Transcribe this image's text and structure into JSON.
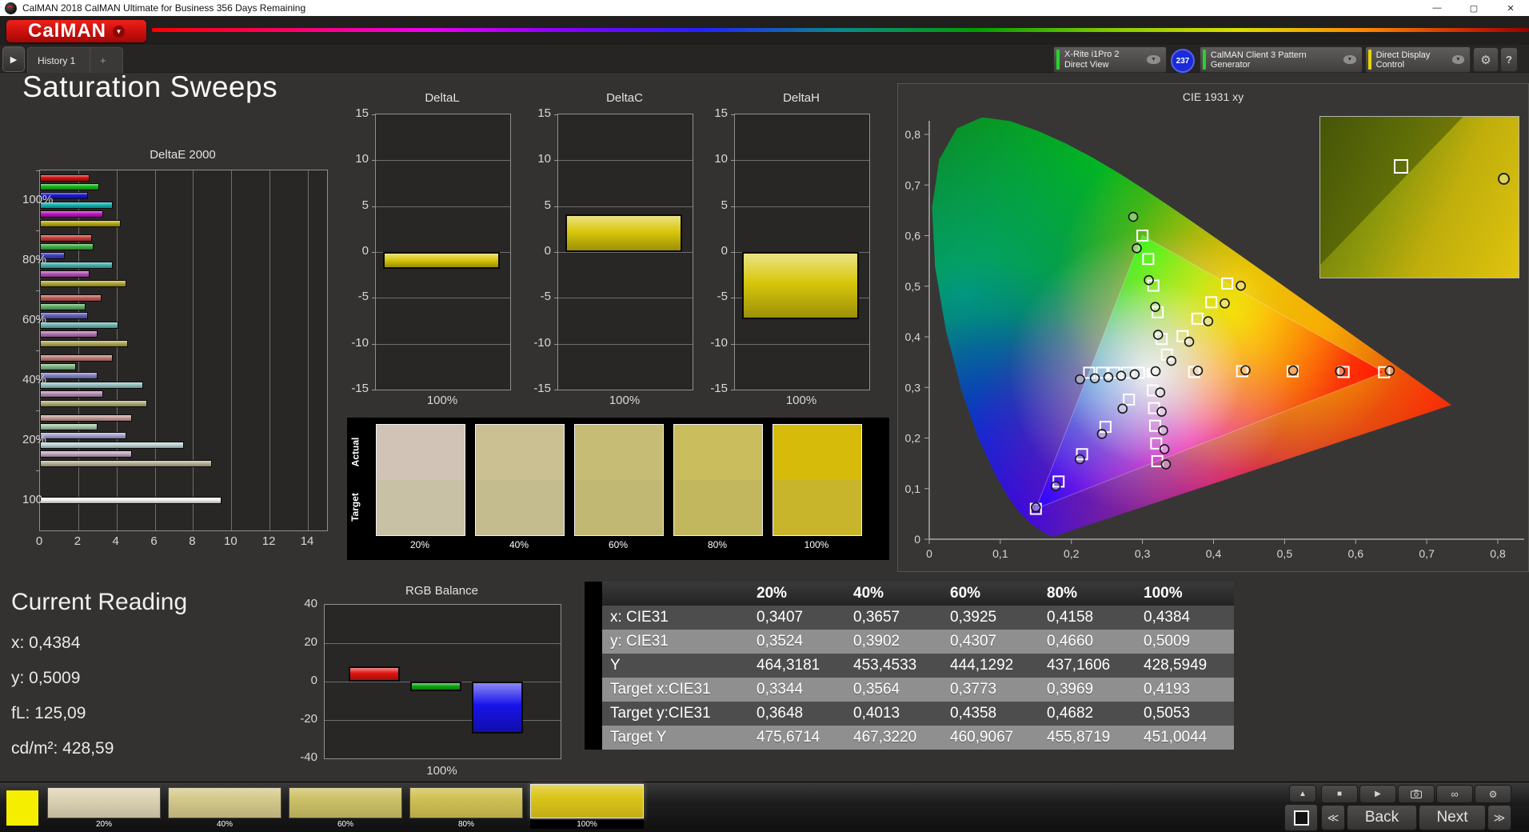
{
  "window": {
    "title": "CalMAN 2018 CalMAN Ultimate for Business 356 Days Remaining",
    "minimize": "—",
    "maximize": "▢",
    "close": "✕"
  },
  "logo": {
    "text": "CalMAN"
  },
  "tabs": {
    "history": "History 1",
    "add": "+"
  },
  "toolbar": {
    "meter": {
      "line1": "X-Rite i1Pro 2",
      "line2": "Direct View",
      "stripe": "#27d32b",
      "badge": "237"
    },
    "source": {
      "label": "CalMAN Client 3 Pattern Generator",
      "stripe": "#27d32b"
    },
    "display": {
      "label": "Direct Display Control",
      "stripe": "#e8d40a"
    },
    "settings": "⚙",
    "help": "?",
    "collapse": "◀"
  },
  "page": {
    "title": "Saturation Sweeps"
  },
  "current_reading": {
    "title": "Current Reading",
    "lines": [
      "x: 0,4384",
      "y: 0,5009",
      "fL: 125,09",
      "cd/m²: 428,59"
    ]
  },
  "chart_data": [
    {
      "id": "deltaE2000",
      "type": "bar",
      "orientation": "horizontal",
      "title": "DeltaE 2000",
      "xlim": [
        0,
        15
      ],
      "xticks": [
        0,
        2,
        4,
        6,
        8,
        10,
        12,
        14
      ],
      "grid": true,
      "groups": [
        {
          "label": "100%",
          "bars": [
            {
              "name": "Red",
              "value": 2.6,
              "color": "#d01210"
            },
            {
              "name": "Green",
              "value": 3.1,
              "color": "#14b419"
            },
            {
              "name": "Blue",
              "value": 2.5,
              "color": "#1716cf"
            },
            {
              "name": "Cyan",
              "value": 3.8,
              "color": "#12b3b3"
            },
            {
              "name": "Magenta",
              "value": 3.3,
              "color": "#c013c3"
            },
            {
              "name": "Yellow",
              "value": 4.2,
              "color": "#b7ab0e"
            }
          ]
        },
        {
          "label": "80%",
          "bars": [
            {
              "name": "Red",
              "value": 2.7,
              "color": "#c73f38"
            },
            {
              "name": "Green",
              "value": 2.8,
              "color": "#3dae42"
            },
            {
              "name": "Blue",
              "value": 1.3,
              "color": "#3f3ec4"
            },
            {
              "name": "Cyan",
              "value": 3.8,
              "color": "#47b1b1"
            },
            {
              "name": "Magenta",
              "value": 2.6,
              "color": "#b452b4"
            },
            {
              "name": "Yellow",
              "value": 4.5,
              "color": "#b2a733"
            }
          ]
        },
        {
          "label": "60%",
          "bars": [
            {
              "name": "Red",
              "value": 3.2,
              "color": "#c05d57"
            },
            {
              "name": "Green",
              "value": 2.4,
              "color": "#5cb061"
            },
            {
              "name": "Blue",
              "value": 2.5,
              "color": "#6160bd"
            },
            {
              "name": "Cyan",
              "value": 4.1,
              "color": "#6fb6b6"
            },
            {
              "name": "Magenta",
              "value": 3.0,
              "color": "#b273b2"
            },
            {
              "name": "Yellow",
              "value": 4.6,
              "color": "#b0a854"
            }
          ]
        },
        {
          "label": "40%",
          "bars": [
            {
              "name": "Red",
              "value": 3.8,
              "color": "#c17d78"
            },
            {
              "name": "Green",
              "value": 1.9,
              "color": "#7fb883"
            },
            {
              "name": "Blue",
              "value": 3.0,
              "color": "#8382c4"
            },
            {
              "name": "Cyan",
              "value": 5.4,
              "color": "#97c2c2"
            },
            {
              "name": "Magenta",
              "value": 3.3,
              "color": "#b78fb7"
            },
            {
              "name": "Yellow",
              "value": 5.6,
              "color": "#b2ab76"
            }
          ]
        },
        {
          "label": "20%",
          "bars": [
            {
              "name": "Red",
              "value": 4.8,
              "color": "#c59d99"
            },
            {
              "name": "Green",
              "value": 3.0,
              "color": "#a3c6a6"
            },
            {
              "name": "Blue",
              "value": 4.5,
              "color": "#a6a5cf"
            },
            {
              "name": "Cyan",
              "value": 7.5,
              "color": "#bdd3d4"
            },
            {
              "name": "Magenta",
              "value": 4.8,
              "color": "#c2a9c2"
            },
            {
              "name": "Yellow",
              "value": 9.0,
              "color": "#b7b194"
            }
          ]
        },
        {
          "label": "100",
          "bars": [
            {
              "name": "White",
              "value": 9.5,
              "color": "#f0f0f0"
            }
          ]
        }
      ]
    },
    {
      "id": "deltaL",
      "type": "bar",
      "title": "DeltaL",
      "ylim": [
        -15,
        15
      ],
      "yticks": [
        15,
        10,
        5,
        0,
        -5,
        -10,
        -15
      ],
      "xlabel": "100%",
      "value": -1.8,
      "color": "#d8c70b"
    },
    {
      "id": "deltaC",
      "type": "bar",
      "title": "DeltaC",
      "ylim": [
        -15,
        15
      ],
      "yticks": [
        15,
        10,
        5,
        0,
        -5,
        -10,
        -15
      ],
      "xlabel": "100%",
      "value": 4.1,
      "color": "#d8c70b"
    },
    {
      "id": "deltaH",
      "type": "bar",
      "title": "DeltaH",
      "ylim": [
        -15,
        15
      ],
      "yticks": [
        15,
        10,
        5,
        0,
        -5,
        -10,
        -15
      ],
      "xlabel": "100%",
      "value": -7.3,
      "color": "#d8c70b"
    },
    {
      "id": "rgbBalance",
      "type": "bar",
      "title": "RGB Balance",
      "ylim": [
        -40,
        40
      ],
      "yticks": [
        40,
        20,
        0,
        -20,
        -40
      ],
      "xlabel": "100%",
      "bars": [
        {
          "name": "Red",
          "value": 8,
          "color": "#e01310"
        },
        {
          "name": "Green",
          "value": -5,
          "color": "#0da512"
        },
        {
          "name": "Blue",
          "value": -27,
          "color": "#1813ea"
        }
      ]
    },
    {
      "id": "cie1931",
      "type": "scatter",
      "title": "CIE 1931 xy",
      "xlim": [
        0,
        0.8
      ],
      "ylim": [
        0,
        0.8
      ],
      "xtick_labels": [
        "0",
        "0,1",
        "0,2",
        "0,3",
        "0,4",
        "0,5",
        "0,6",
        "0,7",
        "0,8"
      ],
      "ytick_labels": [
        "0",
        "0,1",
        "0,2",
        "0,3",
        "0,4",
        "0,5",
        "0,6",
        "0,7",
        "0,8"
      ],
      "white_point": {
        "target": [
          0.3127,
          0.329
        ],
        "measured": [
          0.3185,
          0.332
        ]
      },
      "sweeps": [
        {
          "name": "Red",
          "target": [
            [
              0.3727,
              0.3305
            ],
            [
              0.4402,
              0.3319
            ],
            [
              0.5114,
              0.3318
            ],
            [
              0.583,
              0.3305
            ],
            [
              0.64,
              0.33
            ]
          ],
          "measured": [
            [
              0.378,
              0.333
            ],
            [
              0.445,
              0.334
            ],
            [
              0.512,
              0.3335
            ],
            [
              0.578,
              0.332
            ],
            [
              0.648,
              0.333
            ]
          ]
        },
        {
          "name": "Green",
          "target": [
            [
              0.327,
              0.3958
            ],
            [
              0.3214,
              0.4485
            ],
            [
              0.3154,
              0.5011
            ],
            [
              0.3082,
              0.5538
            ],
            [
              0.3,
              0.6
            ]
          ],
          "measured": [
            [
              0.322,
              0.404
            ],
            [
              0.318,
              0.459
            ],
            [
              0.309,
              0.512
            ],
            [
              0.292,
              0.575
            ],
            [
              0.287,
              0.637
            ]
          ]
        },
        {
          "name": "Blue",
          "target": [
            [
              0.281,
              0.276
            ],
            [
              0.248,
              0.222
            ],
            [
              0.215,
              0.168
            ],
            [
              0.182,
              0.114
            ],
            [
              0.15,
              0.06
            ]
          ],
          "measured": [
            [
              0.272,
              0.258
            ],
            [
              0.243,
              0.208
            ],
            [
              0.212,
              0.158
            ],
            [
              0.178,
              0.105
            ],
            [
              0.15,
              0.063
            ]
          ]
        },
        {
          "name": "Cyan",
          "target": [
            [
              0.295,
              0.329
            ],
            [
              0.278,
              0.329
            ],
            [
              0.26,
              0.329
            ],
            [
              0.243,
              0.329
            ],
            [
              0.225,
              0.329
            ]
          ],
          "measured": [
            [
              0.289,
              0.326
            ],
            [
              0.27,
              0.323
            ],
            [
              0.252,
              0.32
            ],
            [
              0.233,
              0.318
            ],
            [
              0.212,
              0.316
            ]
          ]
        },
        {
          "name": "Magenta",
          "target": [
            [
              0.3147,
              0.2941
            ],
            [
              0.3163,
              0.2591
            ],
            [
              0.3178,
              0.2242
            ],
            [
              0.3194,
              0.1892
            ],
            [
              0.3209,
              0.1542
            ]
          ],
          "measured": [
            [
              0.325,
              0.29
            ],
            [
              0.327,
              0.252
            ],
            [
              0.329,
              0.215
            ],
            [
              0.331,
              0.178
            ],
            [
              0.333,
              0.148
            ]
          ]
        },
        {
          "name": "Yellow",
          "target": [
            [
              0.3344,
              0.3648
            ],
            [
              0.3564,
              0.4013
            ],
            [
              0.3773,
              0.4358
            ],
            [
              0.3969,
              0.4682
            ],
            [
              0.4193,
              0.5053
            ]
          ],
          "measured": [
            [
              0.3407,
              0.3524
            ],
            [
              0.3657,
              0.3902
            ],
            [
              0.3925,
              0.4307
            ],
            [
              0.4158,
              0.466
            ],
            [
              0.4384,
              0.5009
            ]
          ]
        }
      ],
      "inset": {
        "square_pos": [
          0.4,
          0.3
        ],
        "circle_pos": [
          0.92,
          0.38
        ]
      }
    },
    {
      "id": "sweepSwatches",
      "type": "table",
      "row_labels": [
        "Actual",
        "Target"
      ],
      "columns": [
        "20%",
        "40%",
        "60%",
        "80%",
        "100%"
      ],
      "actual_colors": [
        "#d1c4b6",
        "#cac092",
        "#c7bc75",
        "#c9bd5e",
        "#d6bb0a"
      ],
      "target_colors": [
        "#c9c1a5",
        "#c4bb8e",
        "#c1b874",
        "#c2b75e",
        "#c9b52c"
      ]
    },
    {
      "id": "measurementTable",
      "type": "table",
      "columns": [
        "20%",
        "40%",
        "60%",
        "80%",
        "100%"
      ],
      "rows": [
        {
          "label": "x: CIE31",
          "values": [
            "0,3407",
            "0,3657",
            "0,3925",
            "0,4158",
            "0,4384"
          ]
        },
        {
          "label": "y: CIE31",
          "values": [
            "0,3524",
            "0,3902",
            "0,4307",
            "0,4660",
            "0,5009"
          ]
        },
        {
          "label": "Y",
          "values": [
            "464,3181",
            "453,4533",
            "444,1292",
            "437,1606",
            "428,5949"
          ]
        },
        {
          "label": "Target x:CIE31",
          "values": [
            "0,3344",
            "0,3564",
            "0,3773",
            "0,3969",
            "0,4193"
          ]
        },
        {
          "label": "Target y:CIE31",
          "values": [
            "0,3648",
            "0,4013",
            "0,4358",
            "0,4682",
            "0,5053"
          ]
        },
        {
          "label": "Target Y",
          "values": [
            "475,6714",
            "467,3220",
            "460,9067",
            "455,8719",
            "451,0044"
          ]
        }
      ]
    }
  ],
  "bottom_bar": {
    "current_color": "#f6ee00",
    "patterns": [
      {
        "label": "20%",
        "color": "#ddd3b4"
      },
      {
        "label": "40%",
        "color": "#d4c98c"
      },
      {
        "label": "60%",
        "color": "#cdc167"
      },
      {
        "label": "80%",
        "color": "#d0c052"
      },
      {
        "label": "100%",
        "color": "#dcc61a"
      }
    ],
    "selected_index": 4,
    "back_label": "Back",
    "next_label": "Next",
    "prev_arrow": "≪",
    "next_arrow": "≫",
    "eject": "▲",
    "stop": "■",
    "play": "▶",
    "infinity": "∞",
    "settings": "⚙"
  }
}
